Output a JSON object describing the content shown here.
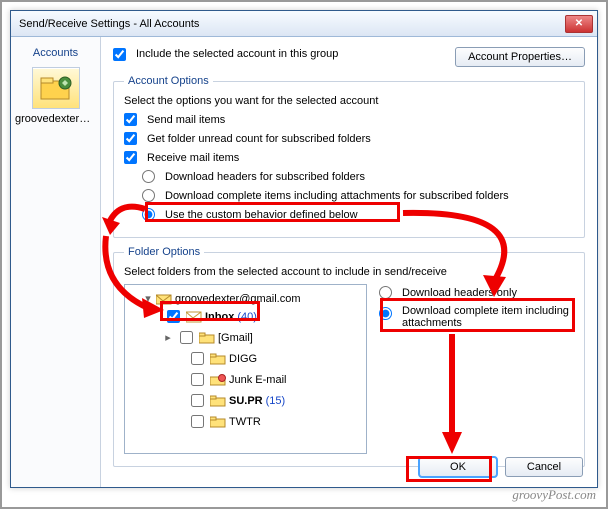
{
  "window": {
    "title": "Send/Receive Settings - All Accounts",
    "close_label": "✕"
  },
  "sidebar": {
    "header": "Accounts",
    "account_label": "groovedexter@…"
  },
  "top": {
    "include_label": "Include the selected account in this group",
    "account_props_btn": "Account Properties…"
  },
  "account_options": {
    "legend": "Account Options",
    "intro": "Select the options you want for the selected account",
    "send_mail": "Send mail items",
    "get_unread": "Get folder unread count for subscribed folders",
    "receive_mail": "Receive mail items",
    "dl_headers": "Download headers for subscribed folders",
    "dl_complete": "Download complete items including attachments for subscribed folders",
    "use_custom": "Use the custom behavior defined below"
  },
  "folder_options": {
    "legend": "Folder Options",
    "intro": "Select folders from the selected account to include in send/receive",
    "root": "groovedexter@gmail.com",
    "inbox": {
      "label": "Inbox",
      "count": "(40)"
    },
    "gmail": "[Gmail]",
    "digg": "DIGG",
    "junk": "Junk E-mail",
    "supr": {
      "label": "SU.PR",
      "count": "(15)"
    },
    "twtr": "TWTR",
    "dl_headers_only": "Download headers only",
    "dl_complete_item": "Download complete item including attachments"
  },
  "buttons": {
    "ok": "OK",
    "cancel": "Cancel"
  },
  "watermark": "groovyPost.com"
}
